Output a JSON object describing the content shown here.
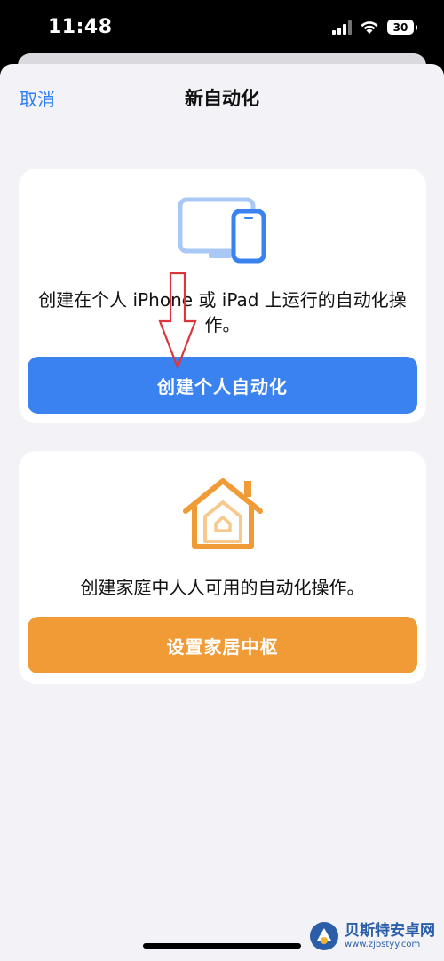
{
  "status_bar": {
    "time": "11:48",
    "battery": "30"
  },
  "nav": {
    "cancel_label": "取消",
    "title": "新自动化"
  },
  "personal_card": {
    "icon": "devices-icon",
    "description": "创建在个人 iPhone 或 iPad 上运行的自动化操作。",
    "button_label": "创建个人自动化",
    "button_color": "#3a82f0"
  },
  "home_card": {
    "icon": "home-icon",
    "description": "创建家庭中人人可用的自动化操作。",
    "button_label": "设置家居中枢",
    "button_color": "#f09b35"
  },
  "watermark": {
    "title": "贝斯特安卓网",
    "url": "www.zjbstyy.com"
  },
  "colors": {
    "accent": "#2f7ef5",
    "background": "#f2f2f7",
    "annotation_arrow": "#d9363e"
  }
}
